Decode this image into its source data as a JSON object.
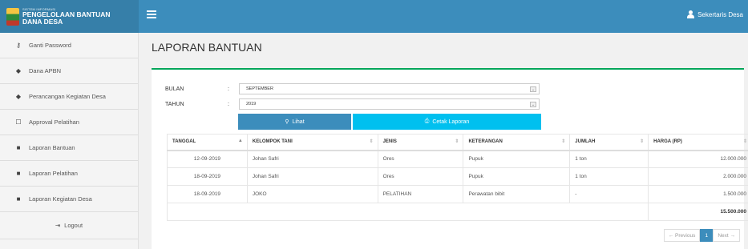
{
  "brand": {
    "subtitle": "SISTEM INFORMASI",
    "title_line1": "PENGELOLAAN BANTUAN",
    "title_line2": "DANA DESA"
  },
  "header": {
    "user_label": "Sekertaris Desa"
  },
  "sidebar": {
    "items": [
      {
        "label": "Ganti Password",
        "icon": "key-icon"
      },
      {
        "label": "Dana APBN",
        "icon": "tag-icon"
      },
      {
        "label": "Perancangan Kegiatan Desa",
        "icon": "tag-icon"
      },
      {
        "label": "Approval Pelatihan",
        "icon": "chat-icon"
      },
      {
        "label": "Laporan Bantuan",
        "icon": "book-icon"
      },
      {
        "label": "Laporan Pelatihan",
        "icon": "book-icon"
      },
      {
        "label": "Laporan Kegiatan Desa",
        "icon": "book-icon"
      }
    ],
    "logout_label": "Logout"
  },
  "page": {
    "title": "LAPORAN BANTUAN"
  },
  "form": {
    "bulan_label": "BULAN",
    "bulan_value": "SEPTEMBER",
    "tahun_label": "TAHUN",
    "tahun_value": "2019",
    "colon": ":",
    "lihat_label": "Lihat",
    "cetak_label": "Cetak Laporan"
  },
  "table": {
    "headers": [
      "TANGGAL",
      "KELOMPOK TANI",
      "JENIS",
      "KETERANGAN",
      "JUMLAH",
      "HARGA (RP)"
    ],
    "rows": [
      [
        "12-09-2019",
        "Johan Safri",
        "Ores",
        "Pupuk",
        "1 ton",
        "12.000.000"
      ],
      [
        "18-09-2019",
        "Johan Safri",
        "Ores",
        "Pupuk",
        "1 ton",
        "2.000.000"
      ],
      [
        "18-09-2019",
        "JOKO",
        "PELATIHAN",
        "Perawatan bibit",
        "-",
        "1.500.000"
      ]
    ],
    "total": "15.500.000"
  },
  "pagination": {
    "previous": "← Previous",
    "current": "1",
    "next": "Next →"
  },
  "colors": {
    "topbar": "#3c8dbc",
    "brand_bg": "#367fa9",
    "box_accent": "#00a65a",
    "btn_lihat": "#3c8dbc",
    "btn_cetak": "#00c0ef"
  }
}
